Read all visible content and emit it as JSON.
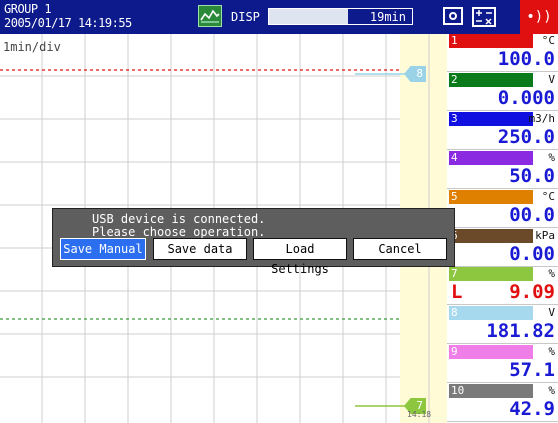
{
  "header": {
    "group": "GROUP 1",
    "datetime": "2005/01/17 14:19:55",
    "disp_icon": "recorder-icon",
    "disp_label": "DISP",
    "memory_progress": 0.55,
    "memory_time": "19min",
    "snapshot_icon": "snapshot-icon",
    "calc_icon": "calc-icon",
    "alarm_icon": "alarm-icon"
  },
  "chart": {
    "div_label": "1min/div",
    "time_label": "14:18",
    "markers": [
      {
        "label": "8",
        "color": "#9ad3e8"
      },
      {
        "label": "7",
        "color": "#8dc63f"
      }
    ],
    "colors": {
      "red_trace": "#e01010",
      "green_trace": "#3a9a3a",
      "scale_band": "#fffbd6"
    }
  },
  "channels": [
    {
      "num": "1",
      "unit": "°C",
      "value": "100.0",
      "color": "#e01010",
      "value_color": "#1a1ad4",
      "alarm": ""
    },
    {
      "num": "2",
      "unit": "V",
      "value": "0.000",
      "color": "#0a7a1a",
      "value_color": "#1a1ad4",
      "alarm": ""
    },
    {
      "num": "3",
      "unit": "m3/h",
      "value": "250.0",
      "color": "#1010e0",
      "value_color": "#1a1ad4",
      "alarm": ""
    },
    {
      "num": "4",
      "unit": "%",
      "value": "50.0",
      "color": "#8a2be2",
      "value_color": "#1a1ad4",
      "alarm": ""
    },
    {
      "num": "5",
      "unit": "°C",
      "value": "00.0",
      "color": "#e08000",
      "value_color": "#1a1ad4",
      "alarm": ""
    },
    {
      "num": "6",
      "unit": "kPa",
      "value": "0.00",
      "color": "#6b4a2a",
      "value_color": "#1a1ad4",
      "alarm": ""
    },
    {
      "num": "7",
      "unit": "%",
      "value": "9.09",
      "color": "#8dc63f",
      "value_color": "#e01010",
      "alarm": "L"
    },
    {
      "num": "8",
      "unit": "V",
      "value": "181.82",
      "color": "#a6d8ee",
      "value_color": "#1a1ad4",
      "alarm": ""
    },
    {
      "num": "9",
      "unit": "%",
      "value": "57.1",
      "color": "#f07ee8",
      "value_color": "#1a1ad4",
      "alarm": ""
    },
    {
      "num": "10",
      "unit": "%",
      "value": "42.9",
      "color": "#7a7a7a",
      "value_color": "#1a1ad4",
      "alarm": ""
    }
  ],
  "dialog": {
    "line1": "USB device is connected.",
    "line2": "Please choose operation.",
    "buttons": [
      "Save Manual",
      "Save data",
      "Load Settings",
      "Cancel"
    ]
  }
}
